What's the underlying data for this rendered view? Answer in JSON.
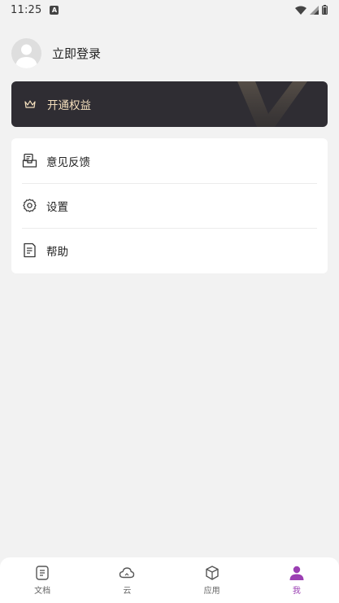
{
  "status_bar": {
    "time": "11:25",
    "notification_glyph": "A"
  },
  "profile": {
    "login_label": "立即登录"
  },
  "vip": {
    "label": "开通权益",
    "text_color": "#f4dfbd",
    "background": "#2f2d33"
  },
  "menu": {
    "items": [
      {
        "label": "意见反馈",
        "icon": "feedback-icon"
      },
      {
        "label": "设置",
        "icon": "gear-icon"
      },
      {
        "label": "帮助",
        "icon": "help-document-icon"
      }
    ]
  },
  "bottom_nav": {
    "active_color": "#9b3fb3",
    "tabs": [
      {
        "label": "文档",
        "icon": "document-icon",
        "active": false
      },
      {
        "label": "云",
        "icon": "cloud-icon",
        "active": false
      },
      {
        "label": "应用",
        "icon": "box-icon",
        "active": false
      },
      {
        "label": "我",
        "icon": "person-icon",
        "active": true
      }
    ]
  }
}
